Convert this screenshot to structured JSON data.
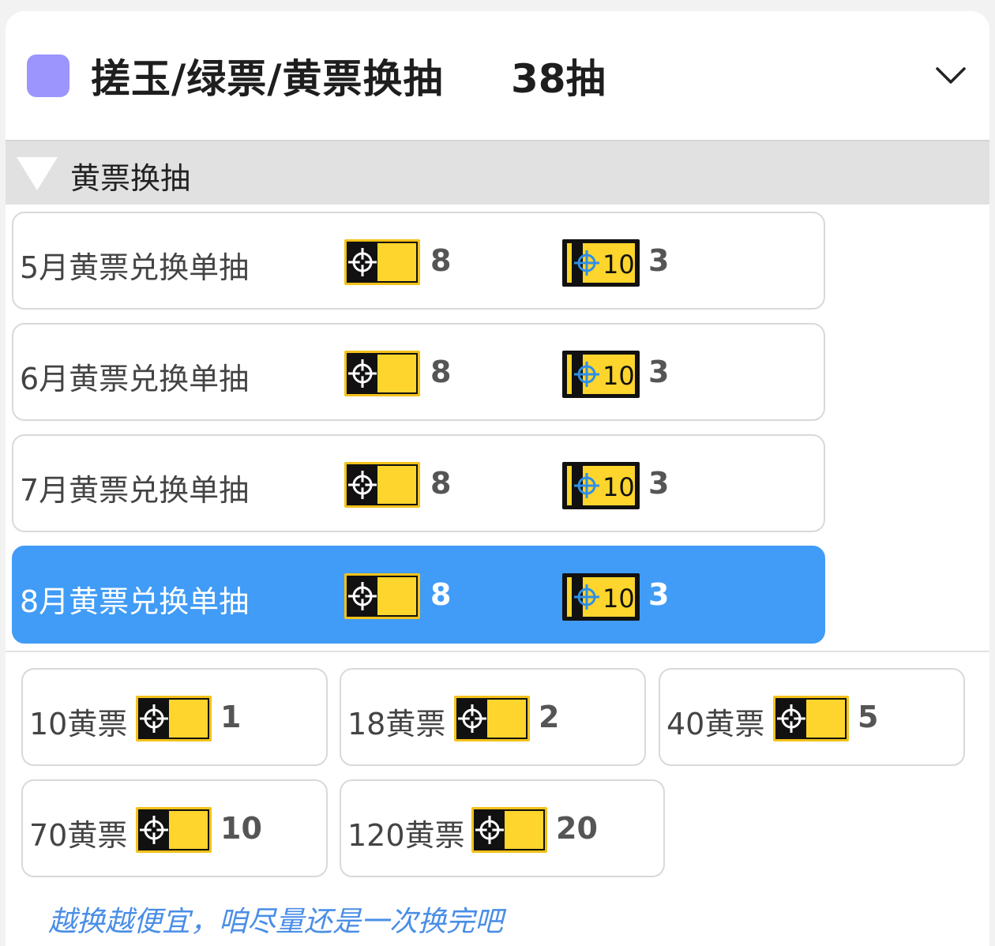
{
  "header": {
    "title": "搓玉/绿票/黄票换抽",
    "count": "38抽",
    "swatch_color": "#9b95fd",
    "toggle_icon": "chevron-down-icon"
  },
  "section": {
    "label": "黄票换抽",
    "icon": "triangle-down-icon"
  },
  "rows": [
    {
      "label": "5月黄票兑换单抽",
      "cost": "8",
      "ten_cost": "3",
      "selected": false
    },
    {
      "label": "6月黄票兑换单抽",
      "cost": "8",
      "ten_cost": "3",
      "selected": false
    },
    {
      "label": "7月黄票兑换单抽",
      "cost": "8",
      "ten_cost": "3",
      "selected": false
    },
    {
      "label": "8月黄票兑换单抽",
      "cost": "8",
      "ten_cost": "3",
      "selected": true
    }
  ],
  "buttons": [
    {
      "label": "10黄票",
      "value": "1"
    },
    {
      "label": "18黄票",
      "value": "2"
    },
    {
      "label": "40黄票",
      "value": "5"
    },
    {
      "label": "70黄票",
      "value": "10"
    },
    {
      "label": "120黄票",
      "value": "20"
    }
  ],
  "ticket_icons": {
    "single": "headhunting-permit-icon",
    "ten": "ten-headhunting-permit-icon",
    "ten_label": "10"
  },
  "tip": "越换越便宜，咱尽量还是一次换完吧",
  "colors": {
    "selected": "#409cf6",
    "ticket_yellow": "#fed52c",
    "tip_blue": "#4a8ee6"
  }
}
